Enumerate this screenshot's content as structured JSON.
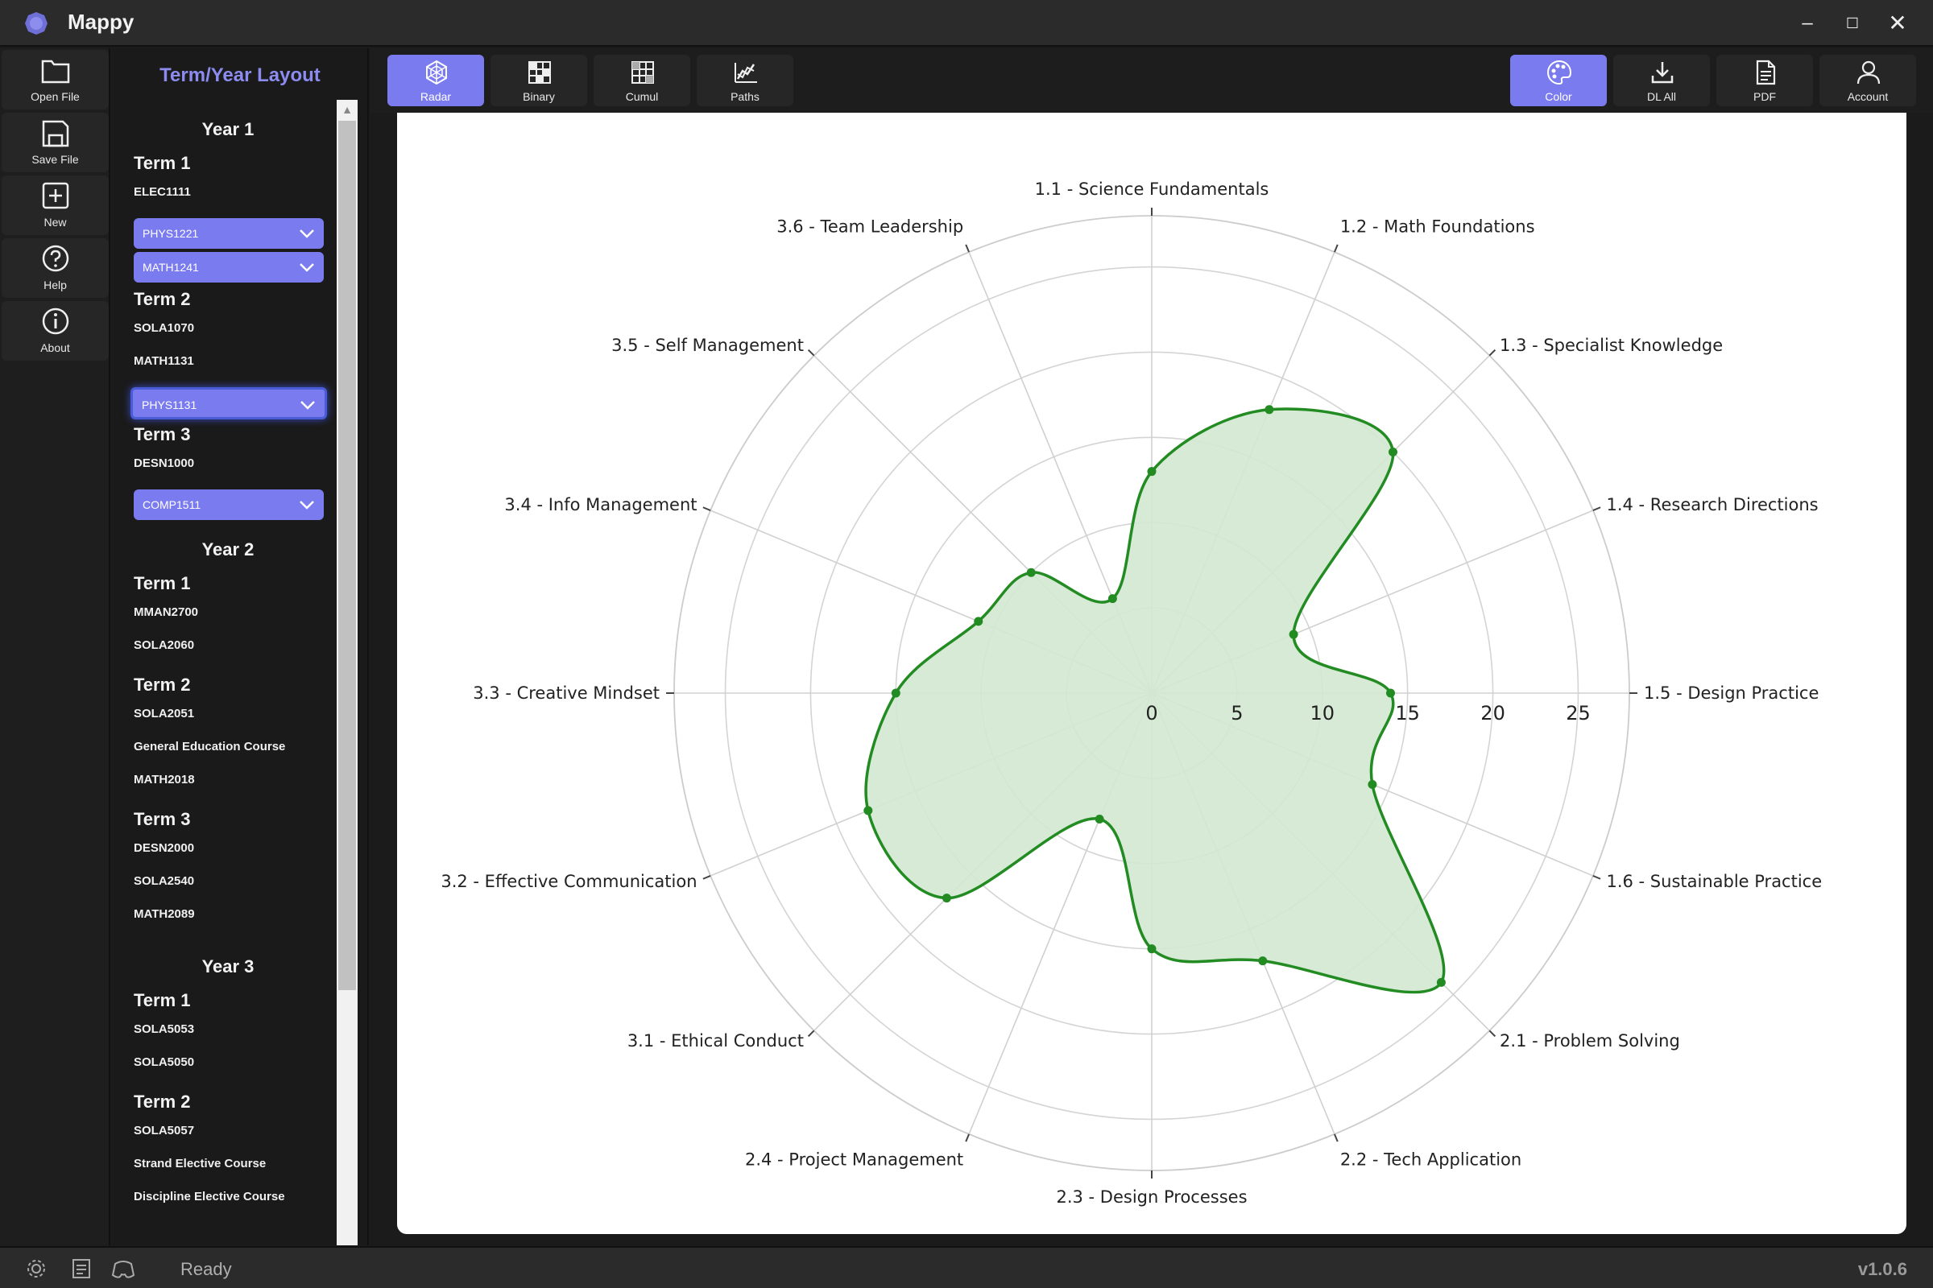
{
  "app": {
    "title": "Mappy",
    "status": "Ready",
    "version": "v1.0.6"
  },
  "rail": [
    {
      "id": "open-file",
      "label": "Open File",
      "icon": "folder-icon"
    },
    {
      "id": "save-file",
      "label": "Save File",
      "icon": "save-icon"
    },
    {
      "id": "new",
      "label": "New",
      "icon": "plus-square-icon"
    },
    {
      "id": "help",
      "label": "Help",
      "icon": "question-circle-icon"
    },
    {
      "id": "about",
      "label": "About",
      "icon": "info-circle-icon"
    }
  ],
  "panel": {
    "title": "Term/Year Layout",
    "years": [
      {
        "label": "Year 1",
        "terms": [
          {
            "label": "Term 1",
            "courses": [
              {
                "code": "ELEC1111",
                "type": "text"
              },
              {
                "code": "PHYS1221",
                "type": "dropdown"
              },
              {
                "code": "MATH1241",
                "type": "dropdown"
              }
            ]
          },
          {
            "label": "Term 2",
            "courses": [
              {
                "code": "SOLA1070",
                "type": "text"
              },
              {
                "code": "MATH1131",
                "type": "text"
              },
              {
                "code": "PHYS1131",
                "type": "dropdown",
                "selected": true
              }
            ]
          },
          {
            "label": "Term 3",
            "courses": [
              {
                "code": "DESN1000",
                "type": "text"
              },
              {
                "code": "COMP1511",
                "type": "dropdown"
              }
            ]
          }
        ]
      },
      {
        "label": "Year 2",
        "terms": [
          {
            "label": "Term 1",
            "courses": [
              {
                "code": "MMAN2700",
                "type": "text"
              },
              {
                "code": "SOLA2060",
                "type": "text"
              }
            ]
          },
          {
            "label": "Term 2",
            "courses": [
              {
                "code": "SOLA2051",
                "type": "text"
              },
              {
                "code": "General Education Course",
                "type": "text"
              },
              {
                "code": "MATH2018",
                "type": "text"
              }
            ]
          },
          {
            "label": "Term 3",
            "courses": [
              {
                "code": "DESN2000",
                "type": "text"
              },
              {
                "code": "SOLA2540",
                "type": "text"
              },
              {
                "code": "MATH2089",
                "type": "text"
              }
            ]
          }
        ]
      },
      {
        "label": "Year 3",
        "terms": [
          {
            "label": "Term 1",
            "courses": [
              {
                "code": "SOLA5053",
                "type": "text"
              },
              {
                "code": "SOLA5050",
                "type": "text"
              }
            ]
          },
          {
            "label": "Term 2",
            "courses": [
              {
                "code": "SOLA5057",
                "type": "text"
              },
              {
                "code": "Strand Elective Course",
                "type": "text"
              },
              {
                "code": "Discipline Elective Course",
                "type": "text"
              }
            ]
          }
        ]
      }
    ]
  },
  "toolbar": {
    "left": [
      {
        "id": "radar",
        "label": "Radar",
        "icon": "radar-icon",
        "active": true
      },
      {
        "id": "binary",
        "label": "Binary",
        "icon": "grid-icon"
      },
      {
        "id": "cumul",
        "label": "Cumul",
        "icon": "grid-light-icon"
      },
      {
        "id": "paths",
        "label": "Paths",
        "icon": "paths-icon"
      }
    ],
    "right": [
      {
        "id": "color",
        "label": "Color",
        "icon": "palette-icon",
        "active": true
      },
      {
        "id": "dl-all",
        "label": "DL All",
        "icon": "download-icon"
      },
      {
        "id": "pdf",
        "label": "PDF",
        "icon": "pdf-icon"
      },
      {
        "id": "account",
        "label": "Account",
        "icon": "user-icon"
      }
    ]
  },
  "chart_data": {
    "type": "radar",
    "title": "",
    "radial_axis": {
      "range": [
        0,
        28
      ],
      "ticks": [
        0,
        5,
        10,
        15,
        20,
        25
      ]
    },
    "grid": true,
    "categories": [
      "1.1 - Science Fundamentals",
      "1.2 - Math Foundations",
      "1.3 - Specialist Knowledge",
      "1.4 - Research Directions",
      "1.5 - Design Practice",
      "1.6 - Sustainable Practice",
      "2.1 - Problem Solving",
      "2.2 - Tech Application",
      "2.3 - Design Processes",
      "2.4 - Project Management",
      "3.1 - Ethical Conduct",
      "3.2 - Effective Communication",
      "3.3 - Creative Mindset",
      "3.4 - Info Management",
      "3.5 - Self Management",
      "3.6 - Team Leadership"
    ],
    "series": [
      {
        "values": [
          13,
          18,
          20,
          9,
          14,
          14,
          24,
          17,
          15,
          8,
          17,
          18,
          15,
          11,
          10,
          6
        ],
        "color": "#228b22",
        "fill": "#d2e8d2"
      }
    ]
  }
}
